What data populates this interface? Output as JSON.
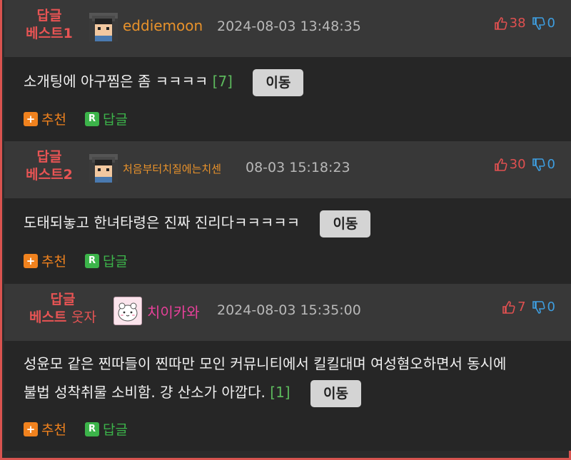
{
  "comments": [
    {
      "best_line1": "답글",
      "best_line2": "베스트1",
      "nick": "eddiemoon",
      "nick_color": "#e8922b",
      "date": "2024-08-03 13:48:35",
      "up": "38",
      "down": "0",
      "text": "소개팅에 아구찜은 좀 ㅋㅋㅋㅋ",
      "reply_count": "[7]",
      "move_label": "이동",
      "recommend_label": "추천",
      "reply_label": "답글",
      "avatar_icon": "pixel-guy-avatar"
    },
    {
      "best_line1": "답글",
      "best_line2": "베스트2",
      "nick": "처음부터치질에는치센",
      "nick_color": "#e8922b",
      "date": "08-03 15:18:23",
      "up": "30",
      "down": "0",
      "text": "도태되놓고 한녀타령은 진짜 진리다ㅋㅋㅋㅋㅋ",
      "reply_count": "",
      "move_label": "이동",
      "recommend_label": "추천",
      "reply_label": "답글",
      "avatar_icon": "pixel-guy-avatar"
    },
    {
      "best_line1": "답글",
      "best_line2": "베스트",
      "best_suffix": "웃자",
      "nick": "치이카와",
      "nick_color": "#e8409a",
      "date": "2024-08-03 15:35:00",
      "up": "7",
      "down": "0",
      "text_line1": "성윤모 같은 찐따들이 찐따만 모인 커뮤니티에서 킬킬대며 여성혐오하면서 동시에",
      "text_line2": "불법 성착취물 소비함. 걍 산소가 아깝다.",
      "reply_count": "[1]",
      "move_label": "이동",
      "recommend_label": "추천",
      "reply_label": "답글",
      "avatar_icon": "chiikawa-avatar"
    }
  ],
  "colors": {
    "best": "#e85454",
    "up": "#e05050",
    "down": "#3e9ee0",
    "recommend": "#f0821e",
    "reply": "#3cb44a"
  },
  "icons": {
    "up": "thumbs-up-icon",
    "down": "thumbs-down-icon",
    "recommend": "plus-icon",
    "reply": "r-icon"
  }
}
